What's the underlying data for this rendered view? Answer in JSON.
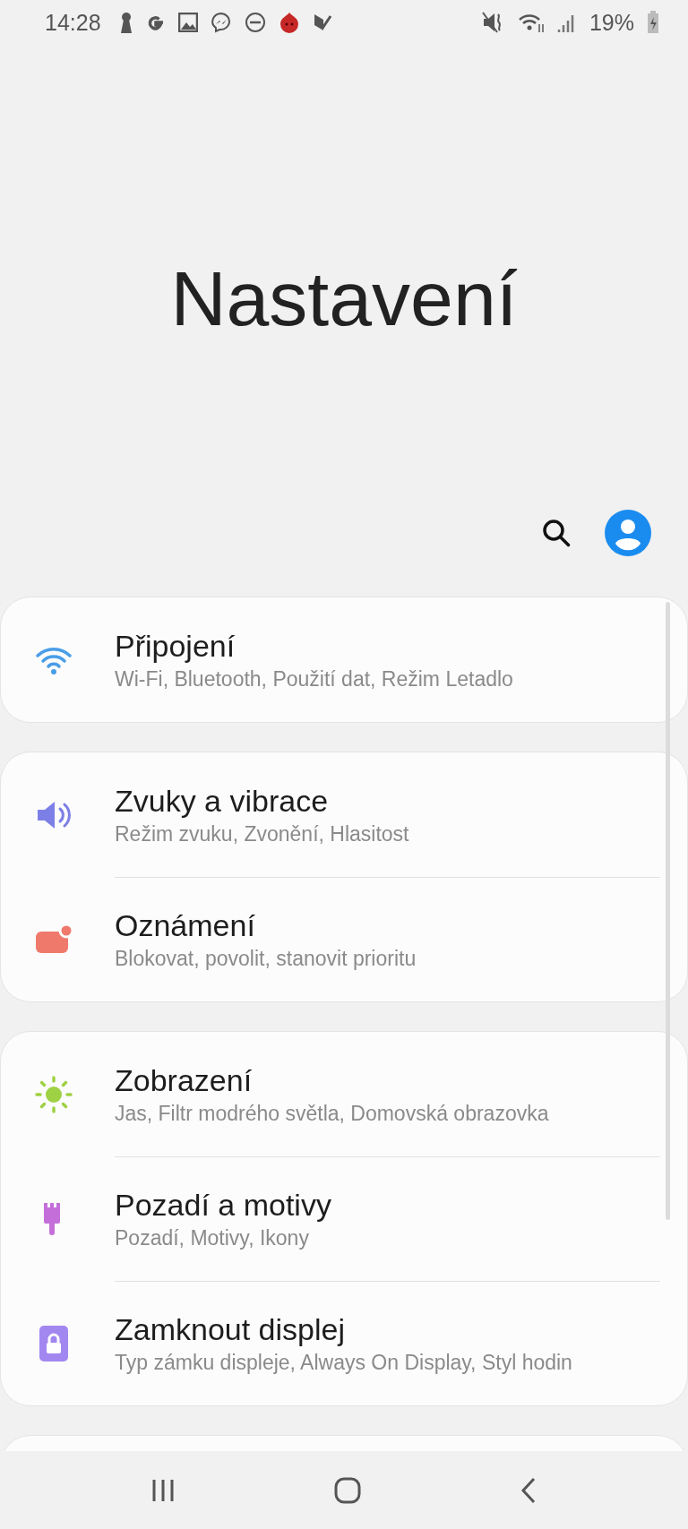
{
  "status_bar": {
    "time": "14:28",
    "battery": "19%"
  },
  "title": "Nastavení",
  "groups": [
    {
      "items": [
        {
          "kind": "wifi",
          "color": "#4a9de8",
          "title": "Připojení",
          "subtitle": "Wi-Fi, Bluetooth, Použití dat, Režim Letadlo"
        }
      ]
    },
    {
      "items": [
        {
          "kind": "sound",
          "color": "#7c7fe6",
          "title": "Zvuky a vibrace",
          "subtitle": "Režim zvuku, Zvonění, Hlasitost"
        },
        {
          "kind": "notification",
          "color": "#ef7a6c",
          "title": "Oznámení",
          "subtitle": "Blokovat, povolit, stanovit prioritu"
        }
      ]
    },
    {
      "items": [
        {
          "kind": "display",
          "color": "#9ed143",
          "title": "Zobrazení",
          "subtitle": "Jas, Filtr modrého světla, Domovská obrazovka"
        },
        {
          "kind": "theme",
          "color": "#c46fd9",
          "title": "Pozadí a motivy",
          "subtitle": "Pozadí, Motivy, Ikony"
        },
        {
          "kind": "lock",
          "color": "#a287f0",
          "title": "Zamknout displej",
          "subtitle": "Typ zámku displeje, Always On Display, Styl hodin"
        }
      ]
    }
  ]
}
